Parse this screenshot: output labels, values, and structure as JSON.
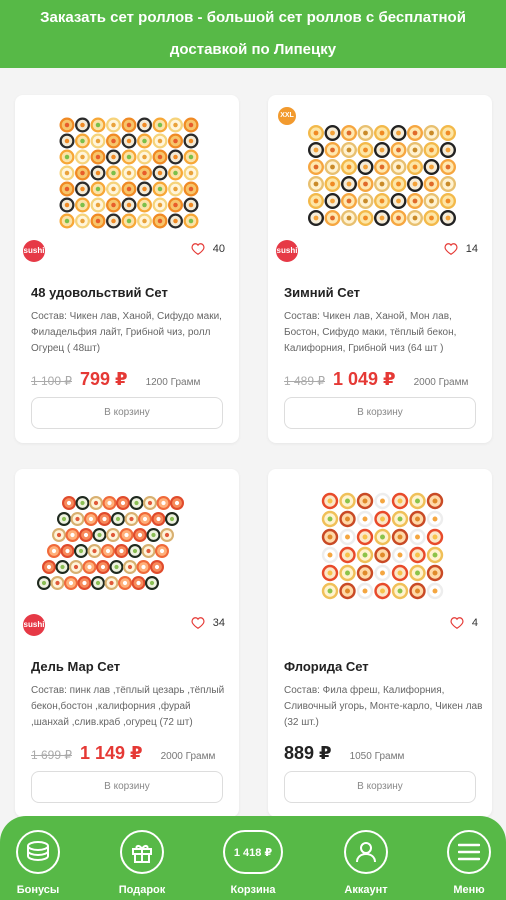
{
  "header": {
    "title": "Заказать сет роллов - большой сет роллов с бесплатной доставкой по Липецку"
  },
  "products": [
    {
      "name": "48 удовольствий Сет",
      "description": "Состав: Чикен лав, Ханой, Сифудо маки, Филадельфия лайт, Грибной чиз, ролл Огурец ( 48шт)",
      "old_price": "1 100 ₽",
      "price": "799 ₽",
      "weight": "1200 Грамм",
      "likes": "40",
      "cart_label": "В корзину",
      "brand_badge": "sushi",
      "xxl_badge": ""
    },
    {
      "name": "Зимний Сет",
      "description": "Состав: Чикен лав, Ханой, Мон лав, Бостон, Сифудо маки, тёплый бекон, Калифорния, Грибной чиз (64 шт )",
      "old_price": "1 489 ₽",
      "price": "1 049 ₽",
      "weight": "2000 Грамм",
      "likes": "14",
      "cart_label": "В корзину",
      "brand_badge": "sushi",
      "xxl_badge": "XXL"
    },
    {
      "name": "Дель Мар Сет",
      "description": "Состав: пинк лав ,тёплый цезарь ,тёплый бекон,бостон ,калифорния ,фурай ,шанхай ,слив.краб ,огурец (72 шт)",
      "old_price": "1 699 ₽",
      "price": "1 149 ₽",
      "weight": "2000 Грамм",
      "likes": "34",
      "cart_label": "В корзину",
      "brand_badge": "sushi",
      "xxl_badge": ""
    },
    {
      "name": "Флорида Сет",
      "description": "Состав: Фила фреш, Калифорния, Сливочный угорь, Монте-карло, Чикен лав (32 шт.)",
      "old_price": "",
      "price": "889 ₽",
      "weight": "1050 Грамм",
      "likes": "4",
      "cart_label": "В корзину",
      "brand_badge": "",
      "xxl_badge": ""
    }
  ],
  "bottom_nav": {
    "bonuses": "Бонусы",
    "gift": "Подарок",
    "cart_total": "1 418 ₽",
    "cart": "Корзина",
    "account": "Аккаунт",
    "menu": "Меню"
  },
  "colors": {
    "brand_green": "#57b947",
    "price_red": "#e53935",
    "badge_red": "#e63946",
    "xxl_orange": "#f29a2e"
  },
  "icons": [
    "coins-icon",
    "gift-icon",
    "user-icon",
    "menu-icon",
    "heart-icon"
  ]
}
